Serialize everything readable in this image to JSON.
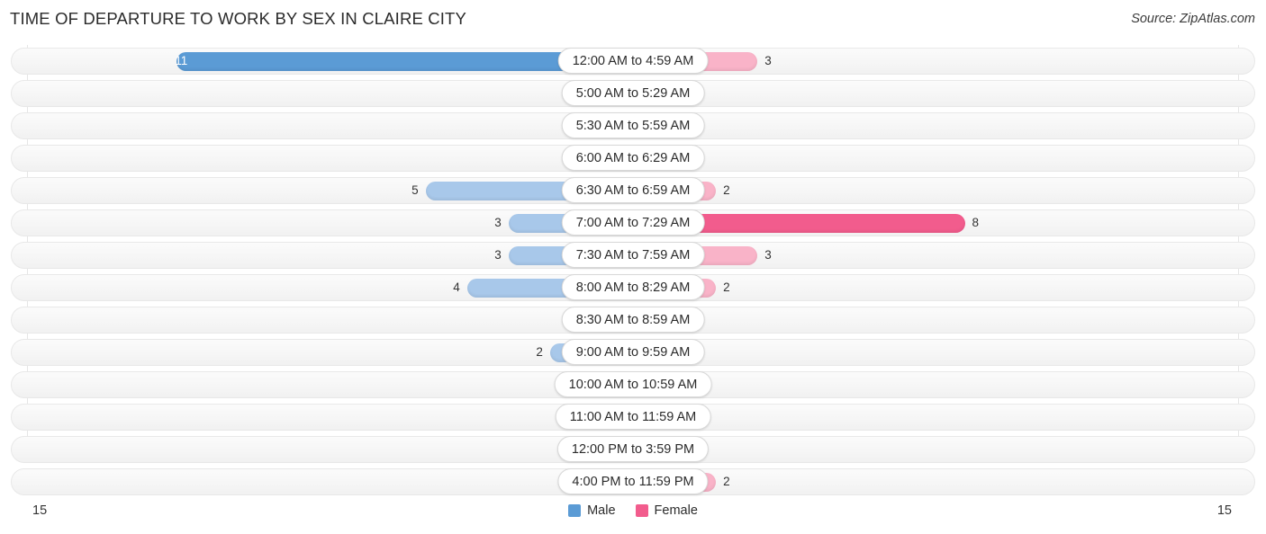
{
  "header": {
    "title": "TIME OF DEPARTURE TO WORK BY SEX IN CLAIRE CITY",
    "source": "Source: ZipAtlas.com"
  },
  "footer": {
    "axis_min_label": "15",
    "axis_max_label": "15"
  },
  "legend": {
    "items": [
      {
        "label": "Male",
        "color": "#5b9bd5"
      },
      {
        "label": "Female",
        "color": "#f25c8d"
      }
    ]
  },
  "colors": {
    "male_strong": "#5b9bd5",
    "male_light": "#a8c8ea",
    "female_strong": "#f25c8d",
    "female_light": "#f9b3c8",
    "track_bg": "#f6f6f6",
    "track_border": "#e8e8e8",
    "gridline": "#e6e6e6"
  },
  "chart_data": {
    "type": "bar",
    "subtype": "diverging-horizontal",
    "title": "TIME OF DEPARTURE TO WORK BY SEX IN CLAIRE CITY",
    "xlabel": "",
    "ylabel": "",
    "axis_max": 15,
    "xlim": [
      15,
      15
    ],
    "grid": true,
    "legend_position": "bottom-center",
    "categories": [
      "12:00 AM to 4:59 AM",
      "5:00 AM to 5:29 AM",
      "5:30 AM to 5:59 AM",
      "6:00 AM to 6:29 AM",
      "6:30 AM to 6:59 AM",
      "7:00 AM to 7:29 AM",
      "7:30 AM to 7:59 AM",
      "8:00 AM to 8:29 AM",
      "8:30 AM to 8:59 AM",
      "9:00 AM to 9:59 AM",
      "10:00 AM to 10:59 AM",
      "11:00 AM to 11:59 AM",
      "12:00 PM to 3:59 PM",
      "4:00 PM to 11:59 PM"
    ],
    "series": [
      {
        "name": "Male",
        "direction": "left",
        "color": "#5b9bd5",
        "values": [
          11,
          0,
          0,
          0,
          5,
          3,
          3,
          4,
          0,
          2,
          0,
          0,
          0,
          0
        ]
      },
      {
        "name": "Female",
        "direction": "right",
        "color": "#f25c8d",
        "values": [
          3,
          0,
          0,
          0,
          2,
          8,
          3,
          2,
          0,
          0,
          0,
          0,
          0,
          2
        ]
      }
    ]
  }
}
